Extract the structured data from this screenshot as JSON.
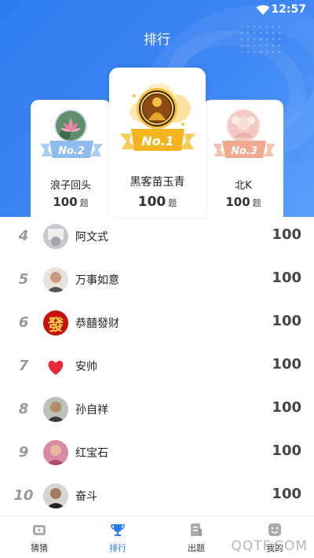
{
  "status_bar": {
    "time": "12:57"
  },
  "page": {
    "title": "排行"
  },
  "colors": {
    "accent": "#2f7af0",
    "gold": "#f5b521",
    "silver": "#9ec3ef",
    "bronze": "#f3a98e"
  },
  "top3": [
    {
      "badge": "No.2",
      "name": "浪子回头",
      "score": "100",
      "unit": "题"
    },
    {
      "badge": "No.1",
      "name": "黑客苗玉青",
      "score": "100",
      "unit": "题"
    },
    {
      "badge": "No.3",
      "name": "北K",
      "score": "100",
      "unit": "题"
    }
  ],
  "rankings": [
    {
      "rank": "4",
      "name": "阿文式",
      "score": "100"
    },
    {
      "rank": "5",
      "name": "万事如意",
      "score": "100"
    },
    {
      "rank": "6",
      "name": "恭囍發财",
      "score": "100",
      "avatar_text": "發"
    },
    {
      "rank": "7",
      "name": "安帅",
      "score": "100"
    },
    {
      "rank": "8",
      "name": "孙自祥",
      "score": "100"
    },
    {
      "rank": "9",
      "name": "红宝石",
      "score": "100"
    },
    {
      "rank": "10",
      "name": "奋斗",
      "score": "100"
    }
  ],
  "tabs": [
    {
      "label": "猜猜",
      "icon": "tv-icon"
    },
    {
      "label": "排行",
      "icon": "trophy-icon",
      "active": true
    },
    {
      "label": "出题",
      "icon": "document-icon"
    },
    {
      "label": "我的",
      "icon": "smile-icon"
    }
  ],
  "watermark": "QQTF.COM"
}
